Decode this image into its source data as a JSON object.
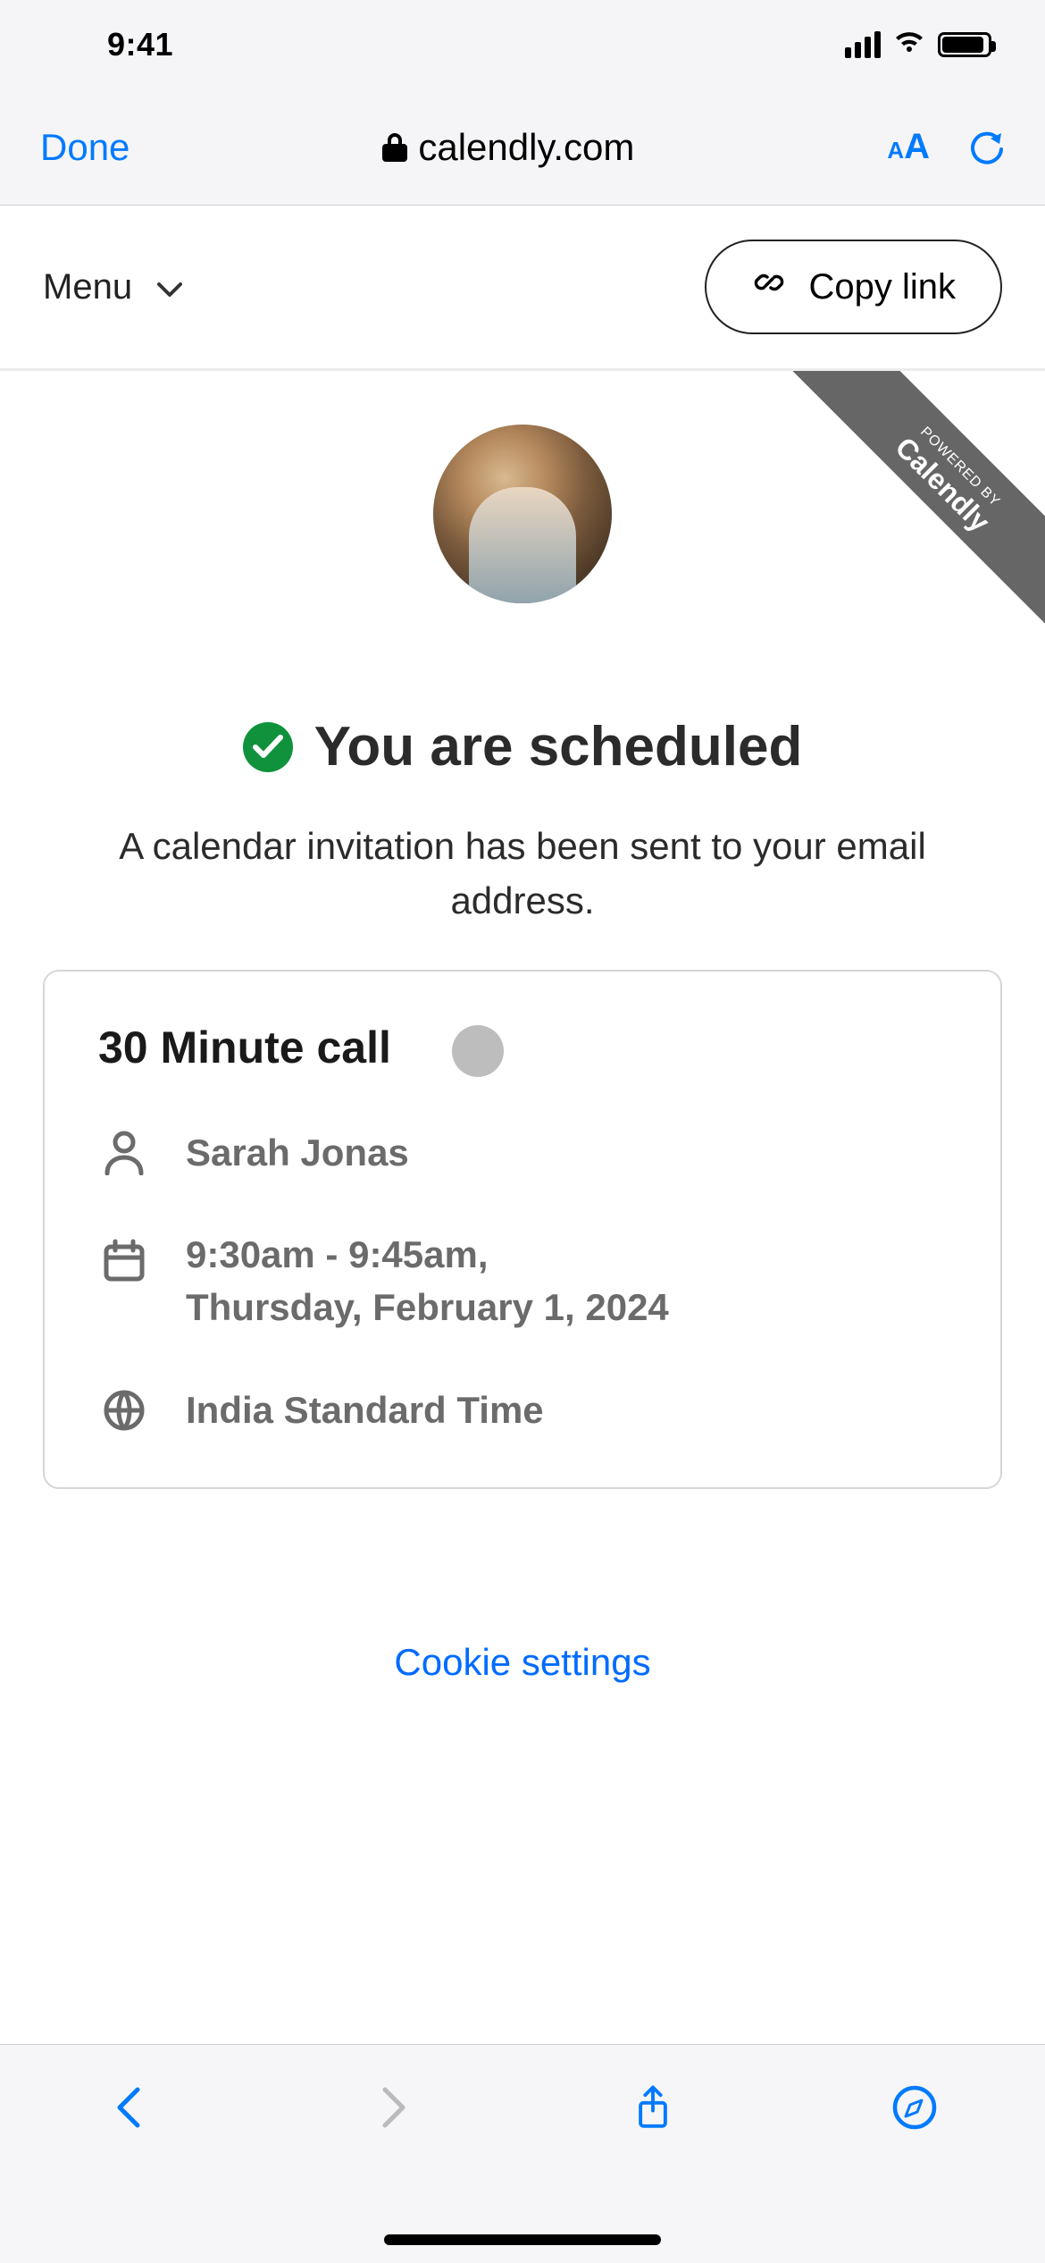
{
  "status_bar": {
    "time": "9:41"
  },
  "browser": {
    "done": "Done",
    "domain": "calendly.com",
    "aa": "A",
    "aa_small": "A"
  },
  "page_header": {
    "menu": "Menu",
    "copy_link": "Copy link"
  },
  "ribbon": {
    "small": "POWERED BY",
    "big": "Calendly"
  },
  "confirmation": {
    "headline": "You are scheduled",
    "subhead": "A calendar invitation has been sent to your email address."
  },
  "event": {
    "title": "30 Minute call",
    "host": "Sarah Jonas",
    "time_line1": "9:30am - 9:45am,",
    "time_line2": "Thursday, February 1, 2024",
    "timezone": "India Standard Time"
  },
  "cookie_link": "Cookie settings"
}
